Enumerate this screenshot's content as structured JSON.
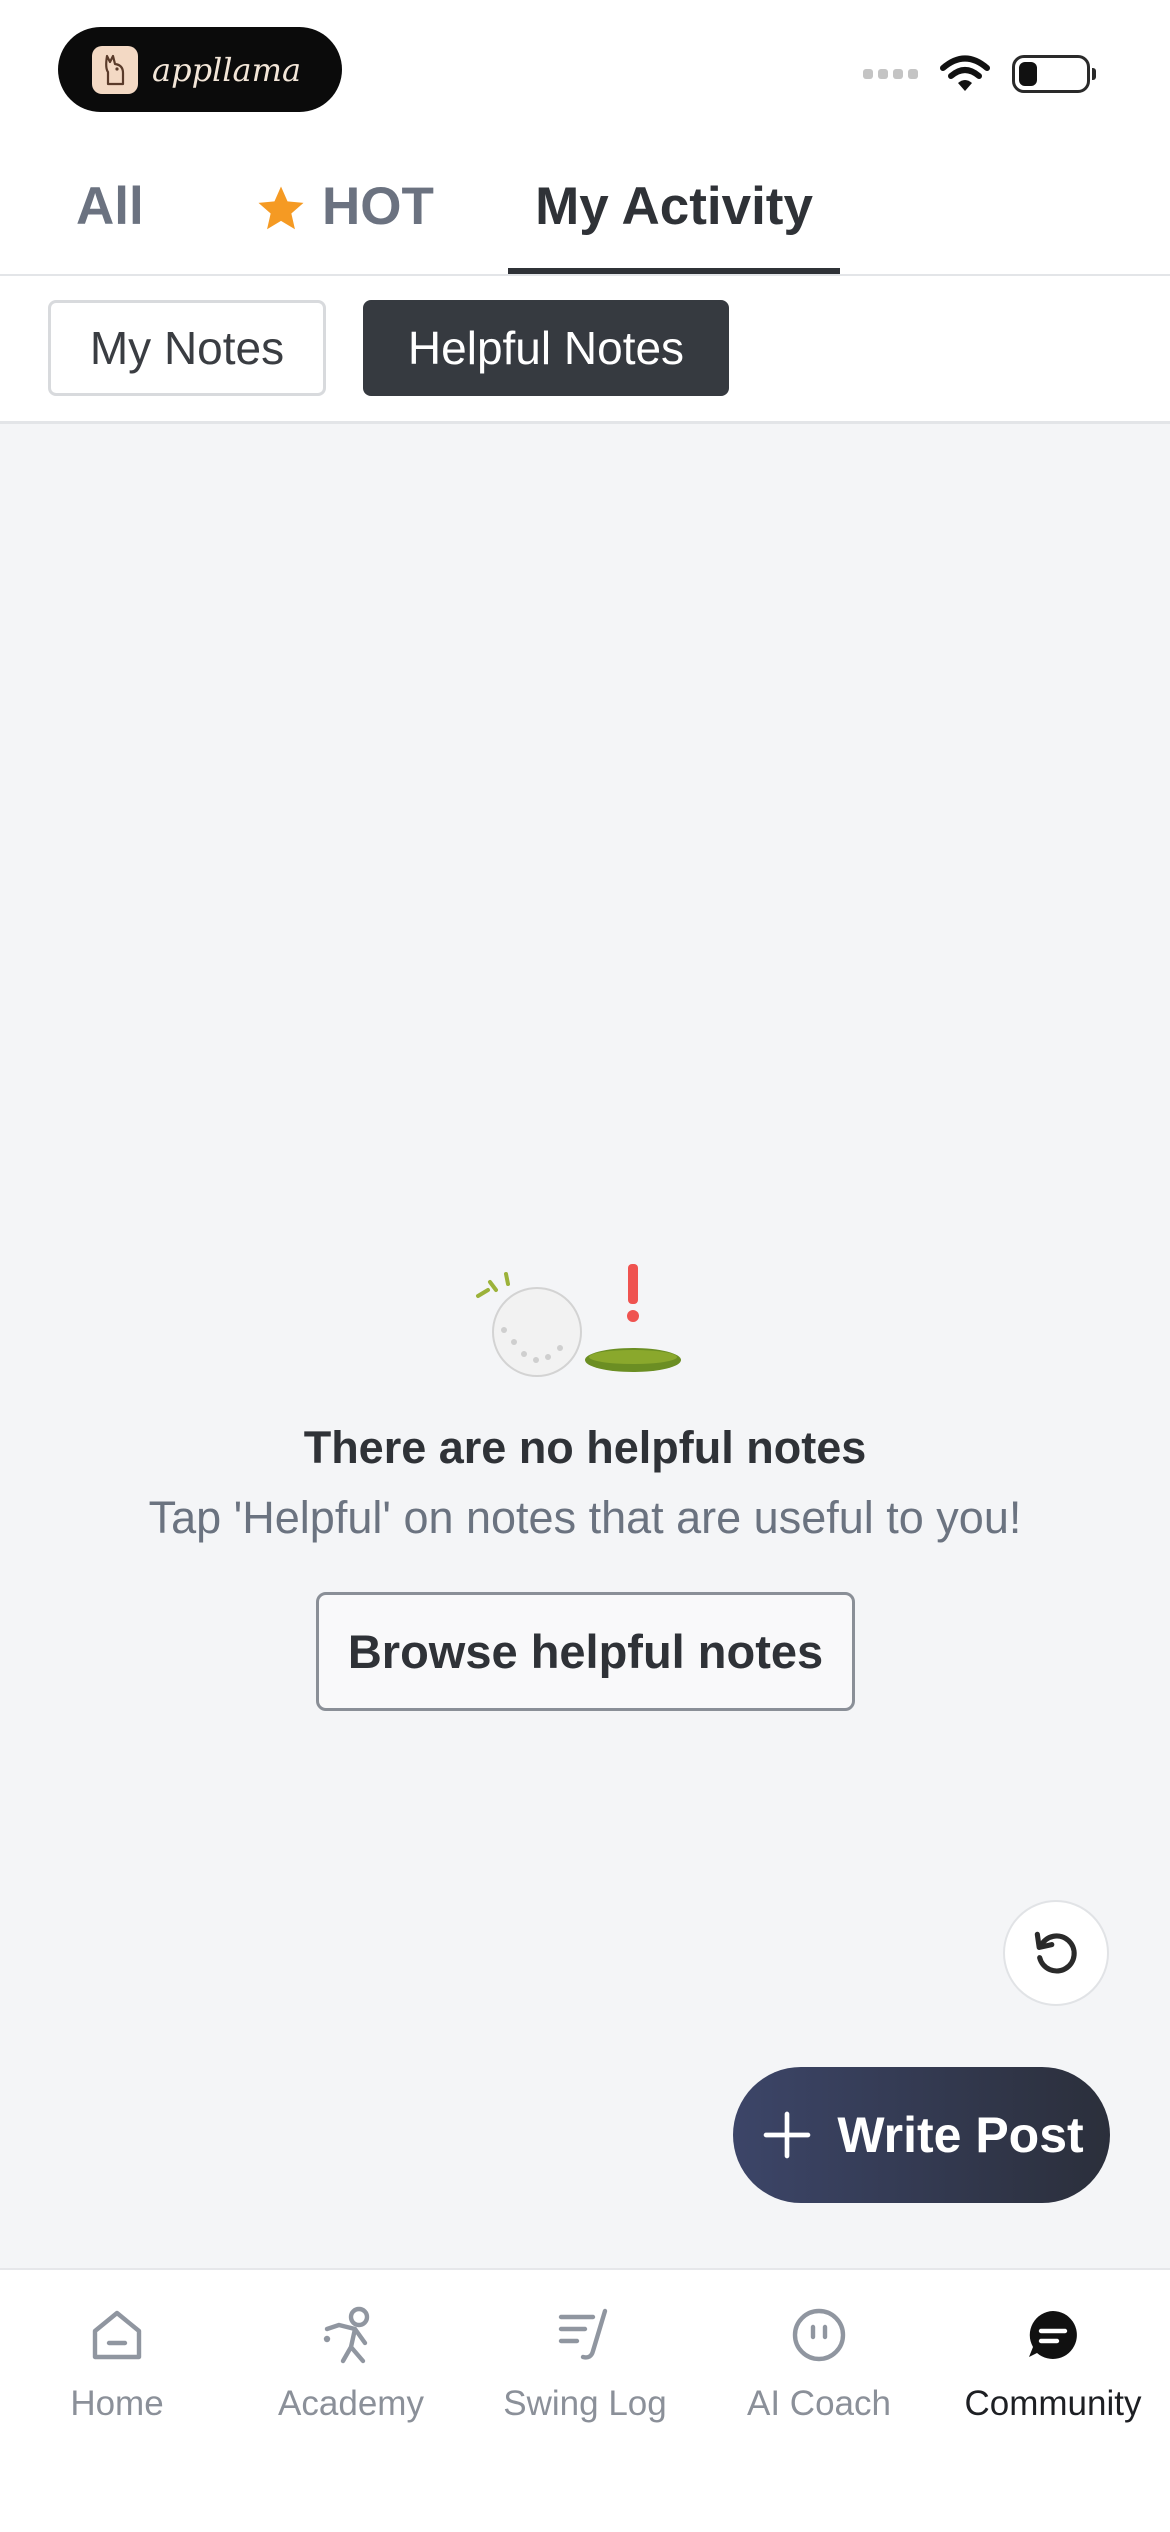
{
  "app": {
    "brand": "appllama"
  },
  "tabs": {
    "all": "All",
    "hot": "HOT",
    "activity": "My Activity"
  },
  "subtabs": {
    "my_notes": "My Notes",
    "helpful_notes": "Helpful Notes"
  },
  "empty_state": {
    "title": "There are no helpful notes",
    "subtitle": "Tap 'Helpful' on notes that are useful to you!",
    "button": "Browse helpful notes"
  },
  "fab": {
    "write_label": "Write Post"
  },
  "bottom_nav": {
    "home": "Home",
    "academy": "Academy",
    "swing_log": "Swing Log",
    "ai_coach": "AI Coach",
    "community": "Community"
  },
  "colors": {
    "accent_dark": "#363a40",
    "fab_gradient_start": "#3c4568",
    "star": "#f59a23",
    "alert": "#ef5350",
    "hole_green": "#6b8e23"
  },
  "status": {
    "battery_level": 0.25
  }
}
